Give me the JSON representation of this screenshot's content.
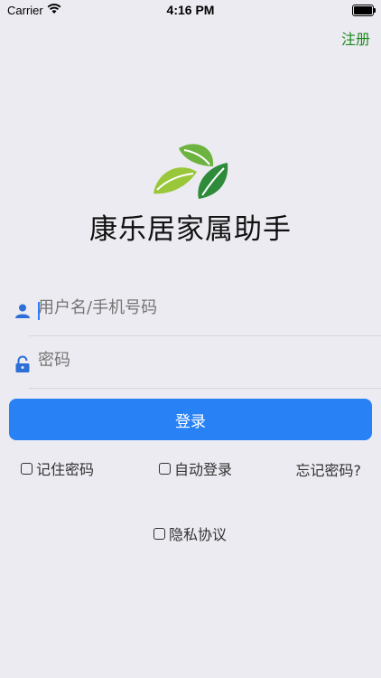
{
  "status_bar": {
    "carrier": "Carrier",
    "time": "4:16 PM"
  },
  "header": {
    "register_label": "注册"
  },
  "app": {
    "title": "康乐居家属助手"
  },
  "form": {
    "username_placeholder": "用户名/手机号码",
    "password_placeholder": "密码",
    "login_label": "登录"
  },
  "options": {
    "remember_password": "记住密码",
    "auto_login": "自动登录",
    "forgot_password": "忘记密码?",
    "privacy_policy": "隐私协议"
  },
  "colors": {
    "accent": "#2882F6",
    "register_green": "#1a8a1a",
    "background": "#EBEBF1"
  },
  "icons": [
    "wifi-icon",
    "battery-icon",
    "leaf-logo",
    "user-icon",
    "lock-icon",
    "checkbox-icon"
  ]
}
